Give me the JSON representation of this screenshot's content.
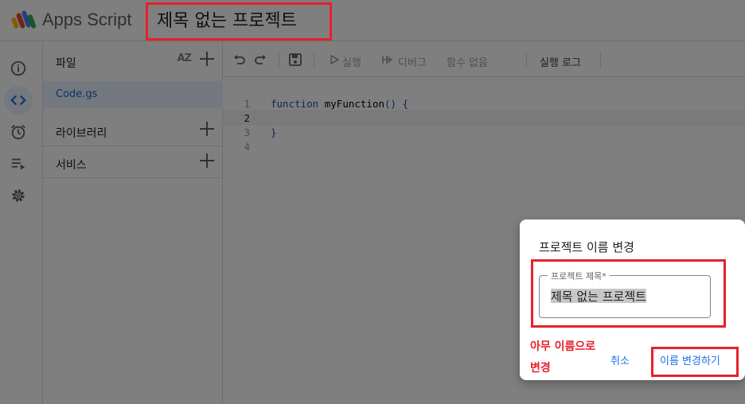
{
  "header": {
    "app_name": "Apps Script",
    "project_title": "제목 없는 프로젝트"
  },
  "rail": {
    "items": [
      {
        "icon": "info-icon",
        "active": false
      },
      {
        "icon": "code-icon",
        "active": true
      },
      {
        "icon": "alarm-clock-icon",
        "active": false
      },
      {
        "icon": "executions-list-icon",
        "active": false
      },
      {
        "icon": "gear-icon",
        "active": false
      }
    ]
  },
  "files_panel": {
    "files_label": "파일",
    "sort_label": "AZ",
    "files": [
      "Code.gs"
    ],
    "libraries_label": "라이브러리",
    "services_label": "서비스"
  },
  "toolbar": {
    "run_label": "실행",
    "debug_label": "디버그",
    "function_label": "함수 없음",
    "execution_log_label": "실행 로그"
  },
  "editor": {
    "line_numbers": [
      "1",
      "2",
      "3",
      "4"
    ],
    "current_line": "2",
    "code_keyword": "function",
    "code_function_name": "myFunction",
    "code_parens": "()",
    "code_open_brace": "{",
    "code_close_brace": "}"
  },
  "dialog": {
    "title": "프로젝트 이름 변경",
    "field_label": "프로젝트 제목*",
    "field_value": "제목 없는 프로젝트",
    "cancel_label": "취소",
    "confirm_label": "이름 변경하기"
  },
  "annotation": {
    "line1": "아무 이름으로",
    "line2": "변경"
  },
  "colors": {
    "highlight_box": "#e8202a",
    "accent_blue": "#1a73e8",
    "scrim": "rgba(0,0,0,0.5)"
  }
}
